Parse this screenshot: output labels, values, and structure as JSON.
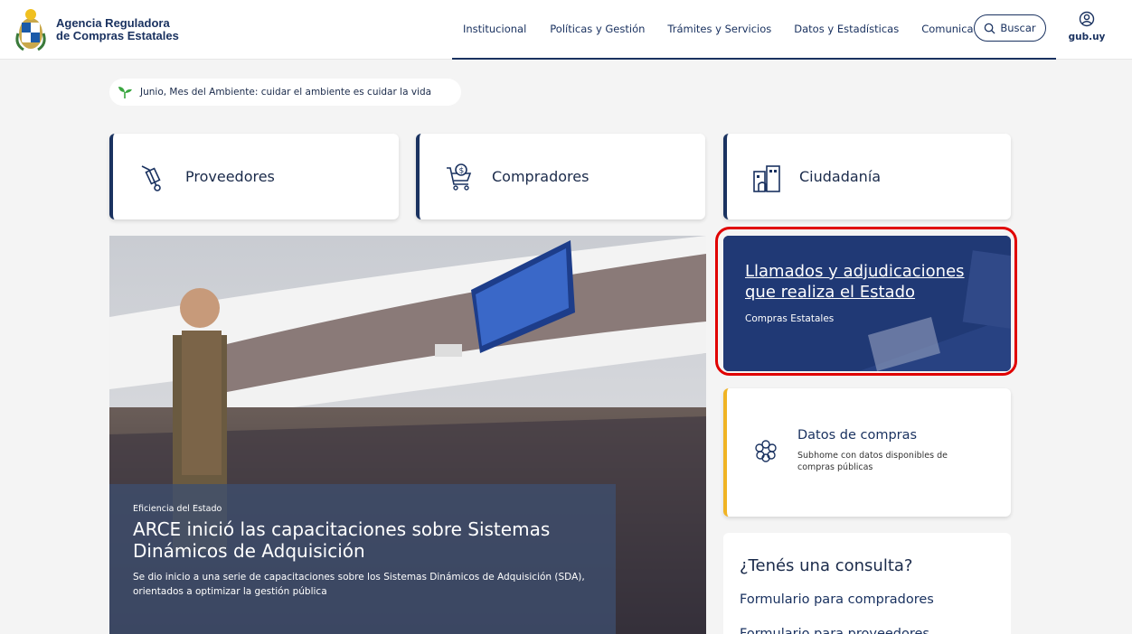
{
  "header": {
    "logo_line1": "Agencia Reguladora",
    "logo_line2": "de Compras Estatales",
    "nav": [
      "Institucional",
      "Políticas y Gestión",
      "Trámites y Servicios",
      "Datos y Estadísticas",
      "Comunicación"
    ],
    "search_label": "Buscar",
    "gubuy_label": "gub.uy"
  },
  "banner": {
    "text": "Junio, Mes del Ambiente: cuidar el ambiente es cuidar la vida"
  },
  "cards": [
    {
      "label": "Proveedores",
      "icon": "hand-truck-icon"
    },
    {
      "label": "Compradores",
      "icon": "shopping-cart-icon"
    },
    {
      "label": "Ciudadanía",
      "icon": "buildings-icon"
    }
  ],
  "hero": {
    "category": "Eficiencia del Estado",
    "title": "ARCE inició las capacitaciones sobre Sistemas Dinámicos de Adquisición",
    "description": "Se dio inicio a una serie de capacitaciones sobre los Sistemas Dinámicos de Adquisición (SDA), orientados a optimizar la gestión pública"
  },
  "feature": {
    "title_line1": "Llamados y adjudicaciones",
    "title_line2": "que realiza el Estado",
    "subtitle": "Compras Estatales"
  },
  "datos": {
    "title": "Datos de compras",
    "description": "Subhome con datos disponibles de compras públicas"
  },
  "consulta": {
    "title": "¿Tenés una consulta?",
    "links": [
      "Formulario para compradores",
      "Formulario para proveedores"
    ]
  },
  "colors": {
    "primary": "#1a3260",
    "accent": "#f0b323",
    "highlight": "#e00000"
  }
}
